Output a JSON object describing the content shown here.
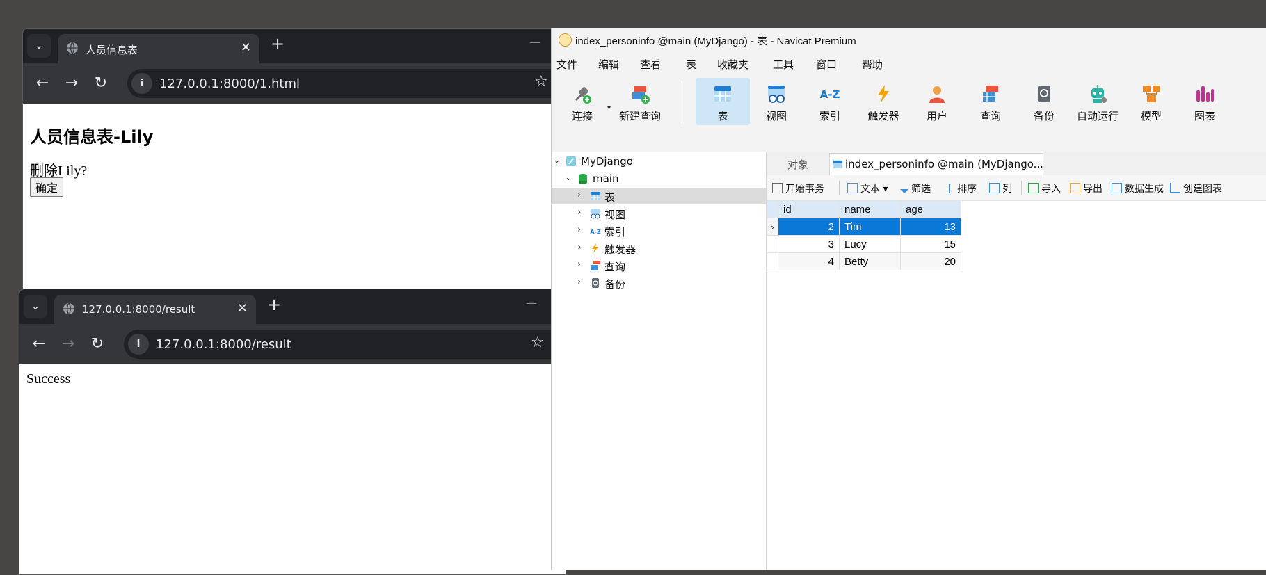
{
  "browser1": {
    "tab_title": "人员信息表",
    "url": "127.0.0.1:8000/1.html",
    "heading": "人员信息表-Lily",
    "prompt": "删除Lily?",
    "confirm_button": "确定"
  },
  "browser2": {
    "tab_title": "127.0.0.1:8000/result",
    "url": "127.0.0.1:8000/result",
    "content": "Success"
  },
  "navicat": {
    "title": "index_personinfo @main (MyDjango) - 表 - Navicat Premium",
    "menu": [
      "文件",
      "编辑",
      "查看",
      "表",
      "收藏夹",
      "工具",
      "窗口",
      "帮助"
    ],
    "ribbon": [
      {
        "label": "连接",
        "icon": "connect-icon"
      },
      {
        "label": "新建查询",
        "icon": "new-query-icon"
      },
      {
        "label": "表",
        "icon": "table-icon",
        "active": true
      },
      {
        "label": "视图",
        "icon": "view-icon"
      },
      {
        "label": "索引",
        "icon": "index-icon"
      },
      {
        "label": "触发器",
        "icon": "trigger-icon"
      },
      {
        "label": "用户",
        "icon": "user-icon"
      },
      {
        "label": "查询",
        "icon": "query-icon"
      },
      {
        "label": "备份",
        "icon": "backup-icon"
      },
      {
        "label": "自动运行",
        "icon": "automation-icon"
      },
      {
        "label": "模型",
        "icon": "model-icon"
      },
      {
        "label": "图表",
        "icon": "chart-icon"
      }
    ],
    "tree": {
      "connection": "MyDjango",
      "database": "main",
      "items": [
        "表",
        "视图",
        "索引",
        "触发器",
        "查询",
        "备份"
      ]
    },
    "object_tab": "对象",
    "table_tab": "index_personinfo @main (MyDjango...",
    "table_toolbar": [
      "开始事务",
      "文本",
      "筛选",
      "排序",
      "列",
      "导入",
      "导出",
      "数据生成",
      "创建图表"
    ],
    "grid": {
      "columns": [
        "id",
        "name",
        "age"
      ],
      "rows": [
        [
          "2",
          "Tim",
          "13"
        ],
        [
          "3",
          "Lucy",
          "15"
        ],
        [
          "4",
          "Betty",
          "20"
        ]
      ],
      "selected_row": 0
    }
  },
  "colors": {
    "desktop": "#474645",
    "chrome_dark": "#202124",
    "chrome_toolbar": "#35363a",
    "navicat_selection": "#0a78d7",
    "ribbon_active": "#cfe6f7"
  }
}
